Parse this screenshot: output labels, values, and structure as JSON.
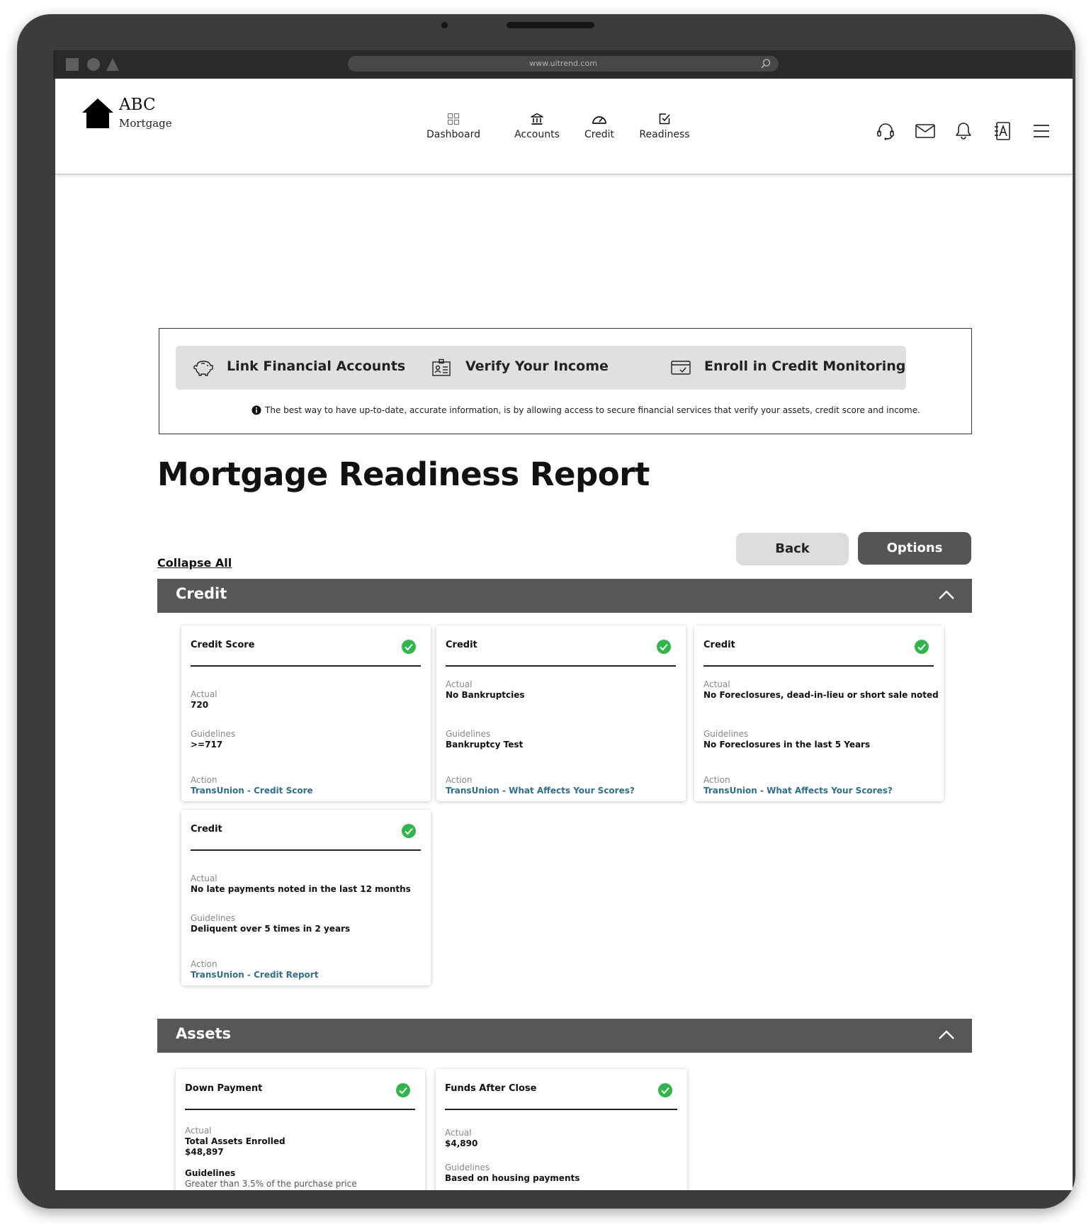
{
  "browser": {
    "url": "www.uitrend.com"
  },
  "brand": {
    "name": "ABC",
    "subtitle": "Mortgage"
  },
  "nav": {
    "items": [
      {
        "label": "Dashboard",
        "icon": "dashboard-icon"
      },
      {
        "label": "Accounts",
        "icon": "bank-icon"
      },
      {
        "label": "Credit",
        "icon": "gauge-icon"
      },
      {
        "label": "Readiness",
        "icon": "checklist-icon"
      }
    ],
    "utility_icons": [
      "headset-icon",
      "mail-icon",
      "bell-icon",
      "contacts-icon",
      "menu-icon"
    ]
  },
  "actions": {
    "link_accounts": "Link Financial Accounts",
    "verify_income": "Verify Your Income",
    "enroll_credit": "Enroll in Credit Monitoring",
    "info": "The best way to have up-to-date, accurate information, is by allowing access to secure financial services that verify your assets, credit score and income."
  },
  "report": {
    "title": "Mortgage Readiness Report",
    "collapse_all": "Collapse All",
    "back": "Back",
    "options": "Options"
  },
  "sections": {
    "credit": {
      "title": "Credit",
      "cards": [
        {
          "title": "Credit Score",
          "actual_label": "Actual",
          "actual": "720",
          "guidelines_label": "Guidelines",
          "guidelines": ">=717",
          "action_label": "Action",
          "action": "TransUnion - Credit Score"
        },
        {
          "title": "Credit",
          "actual_label": "Actual",
          "actual": "No Bankruptcies",
          "guidelines_label": "Guidelines",
          "guidelines": "Bankruptcy Test",
          "action_label": "Action",
          "action": "TransUnion - What Affects Your Scores?"
        },
        {
          "title": "Credit",
          "actual_label": "Actual",
          "actual": "No Foreclosures, dead-in-lieu or short sale noted",
          "guidelines_label": "Guidelines",
          "guidelines": "No Foreclosures in the last 5 Years",
          "action_label": "Action",
          "action": "TransUnion - What Affects Your Scores?"
        },
        {
          "title": "Credit",
          "actual_label": "Actual",
          "actual": "No late payments noted in the last 12 months",
          "guidelines_label": "Guidelines",
          "guidelines": "Deliquent over 5 times in 2 years",
          "action_label": "Action",
          "action": "TransUnion - Credit Report"
        }
      ]
    },
    "assets": {
      "title": "Assets",
      "cards": [
        {
          "title": "Down Payment",
          "actual_label": "Actual",
          "actual_line1": "Total Assets Enrolled",
          "actual_line2": "$48,897",
          "guidelines_label": "Guidelines",
          "guidelines": "Greater than 3.5% of the purchase price"
        },
        {
          "title": "Funds After Close",
          "actual_label": "Actual",
          "actual": "$4,890",
          "guidelines_label": "Guidelines",
          "guidelines": "Based on housing payments"
        }
      ]
    }
  },
  "colors": {
    "section_header": "#575757",
    "check": "#2fb84a",
    "link": "#2e6f93",
    "primary_button": "#555555",
    "secondary_button": "#dcdcdc"
  }
}
